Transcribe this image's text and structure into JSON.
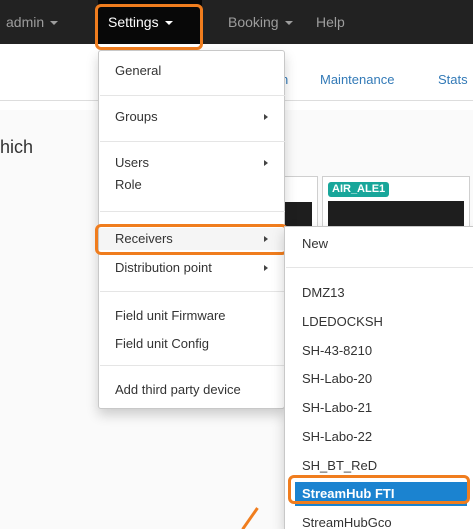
{
  "navbar": {
    "admin_label": "admin",
    "settings_label": "Settings",
    "booking_label": "Booking",
    "help_label": "Help"
  },
  "background": {
    "tab_partial": "n",
    "tab_maintenance": "Maintenance",
    "tab_stats": "Stats",
    "side_text": "hich",
    "badge_label": "AIR_ALE1"
  },
  "settings_menu": {
    "items": [
      {
        "label": "General",
        "has_submenu": false
      },
      {
        "label": "Groups",
        "has_submenu": true
      },
      {
        "label": "Users",
        "has_submenu": true
      },
      {
        "label": "Role",
        "has_submenu": false
      },
      {
        "label": "Receivers",
        "has_submenu": true,
        "active": true
      },
      {
        "label": "Distribution point",
        "has_submenu": true
      },
      {
        "label": "Field unit Firmware",
        "has_submenu": false
      },
      {
        "label": "Field unit Config",
        "has_submenu": false
      },
      {
        "label": "Add third party device",
        "has_submenu": false
      }
    ]
  },
  "receivers_menu": {
    "items": [
      {
        "label": "New"
      },
      {
        "label": "DMZ13"
      },
      {
        "label": "LDEDOCKSH"
      },
      {
        "label": "SH-43-8210"
      },
      {
        "label": "SH-Labo-20"
      },
      {
        "label": "SH-Labo-21"
      },
      {
        "label": "SH-Labo-22"
      },
      {
        "label": "SH_BT_ReD"
      },
      {
        "label": "StreamHub FTI",
        "selected": true
      },
      {
        "label": "StreamHubGco"
      }
    ]
  },
  "colors": {
    "navbar_bg": "#222222",
    "highlight_orange": "#f07d1e",
    "selected_blue": "#1b83d0",
    "badge_teal": "#18a69a"
  }
}
